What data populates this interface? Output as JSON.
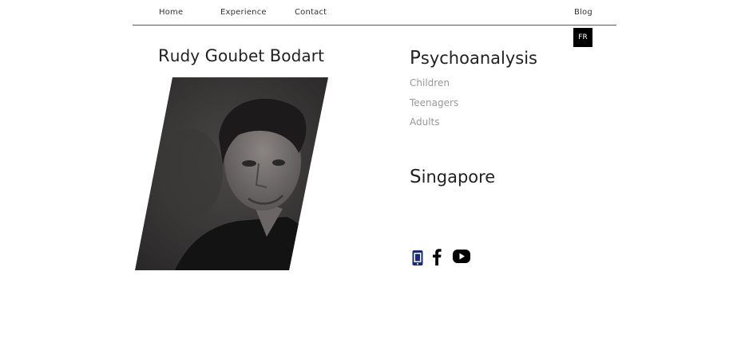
{
  "nav": {
    "home": "Home",
    "experience": "Experience",
    "contact": "Contact",
    "blog": "Blog",
    "language_button": "FR"
  },
  "profile": {
    "name_parts": [
      {
        "initial": "R",
        "rest": "udy "
      },
      {
        "initial": "G",
        "rest": "oubet "
      },
      {
        "initial": "B",
        "rest": "odart"
      }
    ]
  },
  "services": {
    "title_initial": "P",
    "title_rest": "sychoanalysis",
    "items": [
      "Children",
      "Teenagers",
      "Adults"
    ]
  },
  "location": {
    "title_initial": "S",
    "title_rest": "ingapore"
  },
  "social": {
    "icons": [
      "phone-icon",
      "facebook-icon",
      "youtube-icon"
    ]
  },
  "colors": {
    "nav_rule": "#555555",
    "lang_button_bg": "#000000",
    "service_text": "#999999",
    "phone_icon_accent": "#1a2a7a"
  }
}
